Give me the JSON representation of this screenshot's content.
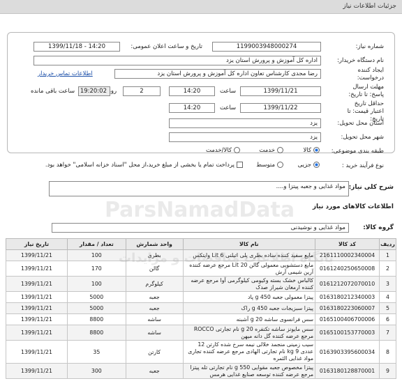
{
  "header": {
    "title": "جزئیات اطلاعات نیاز"
  },
  "form": {
    "need_number_label": "شماره نیاز:",
    "need_number": "1199003948000274",
    "announce_label": "تاریخ و ساعت اعلان عمومی:",
    "announce_value": "1399/11/18 - 14:20",
    "buyer_label": "نام دستگاه خریدار:",
    "buyer_value": "اداره کل آموزش و پرورش استان یزد",
    "creator_label": "ایجاد کننده درخواست:",
    "creator_value": "رضا مجدی کارشناس تعاون اداره کل آموزش و پرورش استان یزد",
    "contact_link": "اطلاعات تماس خریدار",
    "reply_deadline_label": "مهلت ارسال پاسخ: تا تاریخ:",
    "reply_date": "1399/11/21",
    "time_label": "ساعت",
    "reply_time": "14:20",
    "days_value": "2",
    "days_label": "روز و",
    "remaining_time": "19:20:02",
    "remaining_label": "ساعت باقی مانده",
    "validity_label": "حداقل تاریخ اعتبار قیمت: تا تاریخ:",
    "validity_date": "1399/11/22",
    "validity_time": "14:20",
    "province_label": "استان محل تحویل:",
    "province_value": "یزد",
    "city_label": "شهر محل تحویل:",
    "city_value": "یزد",
    "category_label": "طبقه بندی موضوعی:",
    "category_options": [
      "کالا",
      "خدمت",
      "کالا/خدمت"
    ],
    "category_selected": "کالا",
    "process_label": "نوع فرآیند خرید :",
    "process_options": [
      "جزیی",
      "متوسط"
    ],
    "process_selected": "جزیی",
    "payment_note": "پرداخت تمام یا بخشی از مبلغ خرید،از محل \"اسناد خزانه اسلامی\" خواهد بود."
  },
  "summary": {
    "label": "شرح کلی نیاز:",
    "value": "مواد غذایی و جعبه پیتزا و...."
  },
  "goods_section": {
    "title": "اطلاعات کالاهای مورد نیاز",
    "group_label": "گروه کالا:",
    "group_value": "مواد غذایی و نوشیدنی"
  },
  "watermark": {
    "main": "ParsNamadData",
    "sub": "پایگاه اطلاعات مناقصات و مزایدات"
  },
  "table": {
    "headers": [
      "ردیف",
      "کد کالا",
      "نام کالا",
      "واحد شمارش",
      "تعداد / مقدار",
      "تاریخ نیاز"
    ],
    "rows": [
      [
        "1",
        "2161110002340004",
        "مایع سفید کننده ساده بطری پلی اتیلنی 6 Lit وایتکس",
        "بطری",
        "100",
        "1399/11/21"
      ],
      [
        "2",
        "0161240250650008",
        "مایع دستشویی معمولی گالن 20 Lit مرجع عرضه کننده آرین شیمی آرش",
        "گالن",
        "170",
        "1399/11/21"
      ],
      [
        "3",
        "0161212072070010",
        "کالباس خشک بسته وکیومی کیلوگرمی آوا مرجع عرضه کننده ارمغان شیراز صدک",
        "کیلوگرم",
        "100",
        "1399/11/21"
      ],
      [
        "4",
        "0163180212340003",
        "پیتزا معمولی جعبه 450 g پاد",
        "جعبه",
        "5000",
        "1399/11/21"
      ],
      [
        "5",
        "0163180223060007",
        "پیتزا سبزیجات جعبه 450 g راک",
        "جعبه",
        "5000",
        "1399/11/21"
      ],
      [
        "6",
        "0165100406700006",
        "سس فرانسوی ساشه 20 g آشبنه",
        "ساشه",
        "8800",
        "1399/11/21"
      ],
      [
        "7",
        "0165100153770003",
        "سس مایونز ساشه تکنفره 20 g نام تجارتی ROCCO مرجع عرضه کننده گل دانه میهن",
        "ساشه",
        "8800",
        "1399/11/21"
      ],
      [
        "8",
        "0163903395600034",
        "سیب زمینی منجمد خلالی نیمه سرخ شده کارتن 12 عددی 9 kg نام تجارتی الهادی مرجع عرضه کننده تجاری مواد غذایی الثمره",
        "کارتن",
        "35",
        "1399/11/21"
      ],
      [
        "9",
        "0163180128870001",
        "پیتزا مخصوص جعبه مقوایی 550 g نام تجارتی تله پیتزا مرجع عرضه کننده توسعه صنایع غذایی هرمس",
        "جعبه",
        "300",
        "1399/11/21"
      ]
    ]
  }
}
